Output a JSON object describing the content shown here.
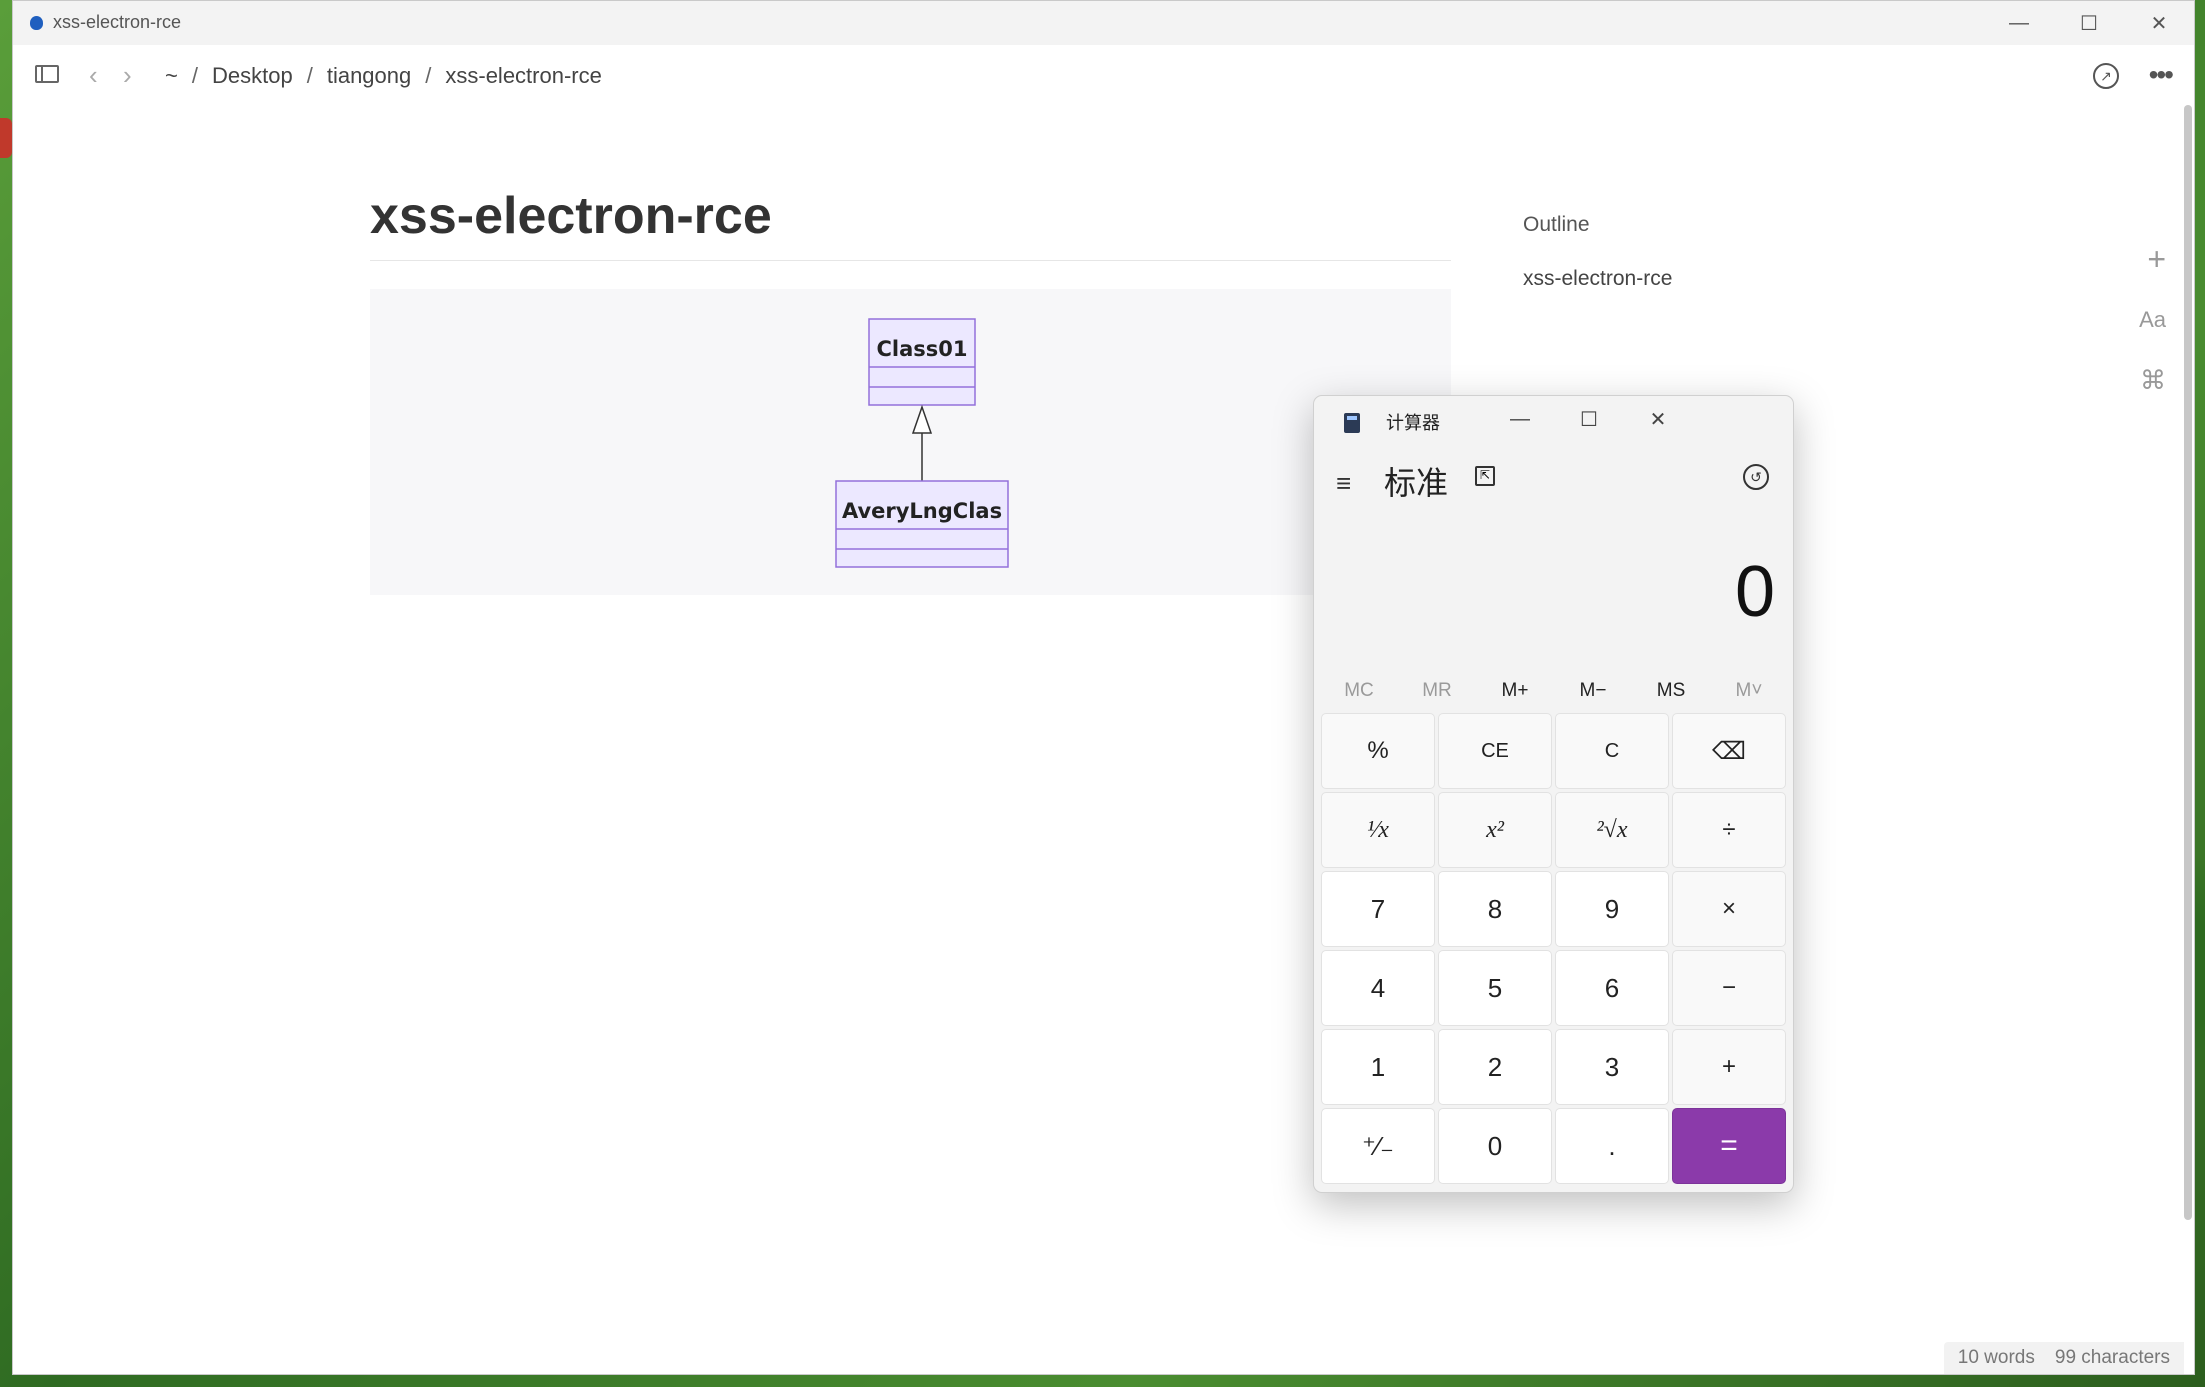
{
  "window": {
    "title": "xss-electron-rce",
    "minimize_glyph": "—",
    "maximize_glyph": "☐",
    "close_glyph": "✕"
  },
  "navbar": {
    "back_glyph": "‹",
    "forward_glyph": "›",
    "breadcrumb": [
      "~",
      "Desktop",
      "tiangong",
      "xss-electron-rce"
    ],
    "separator": "/",
    "share_glyph": "↗",
    "more_glyph": "•••"
  },
  "document": {
    "title": "xss-electron-rce",
    "diagram": {
      "parent_class": "Class01",
      "child_class": "AveryLngClas"
    }
  },
  "outline": {
    "title": "Outline",
    "items": [
      "xss-electron-rce"
    ]
  },
  "side_tools": {
    "plus": "+",
    "font": "Aa",
    "command": "⌘"
  },
  "status": {
    "words": "10 words",
    "characters": "99 characters"
  },
  "calculator": {
    "title": "计算器",
    "mode": "标准",
    "display": "0",
    "min_glyph": "—",
    "max_glyph": "☐",
    "close_glyph": "✕",
    "menu_glyph": "≡",
    "history_glyph": "↺",
    "keep_top_glyph": "⇱",
    "memory": [
      "MC",
      "MR",
      "M+",
      "M−",
      "MS",
      "M˅"
    ],
    "keys": {
      "percent": "%",
      "ce": "CE",
      "c": "C",
      "backspace": "⌫",
      "reciprocal": "¹⁄x",
      "square": "x²",
      "sqrt": "²√x",
      "divide": "÷",
      "seven": "7",
      "eight": "8",
      "nine": "9",
      "multiply": "×",
      "four": "4",
      "five": "5",
      "six": "6",
      "minus": "−",
      "one": "1",
      "two": "2",
      "three": "3",
      "plus": "+",
      "negate": "⁺⁄₋",
      "zero": "0",
      "decimal": ".",
      "equals": "="
    }
  }
}
